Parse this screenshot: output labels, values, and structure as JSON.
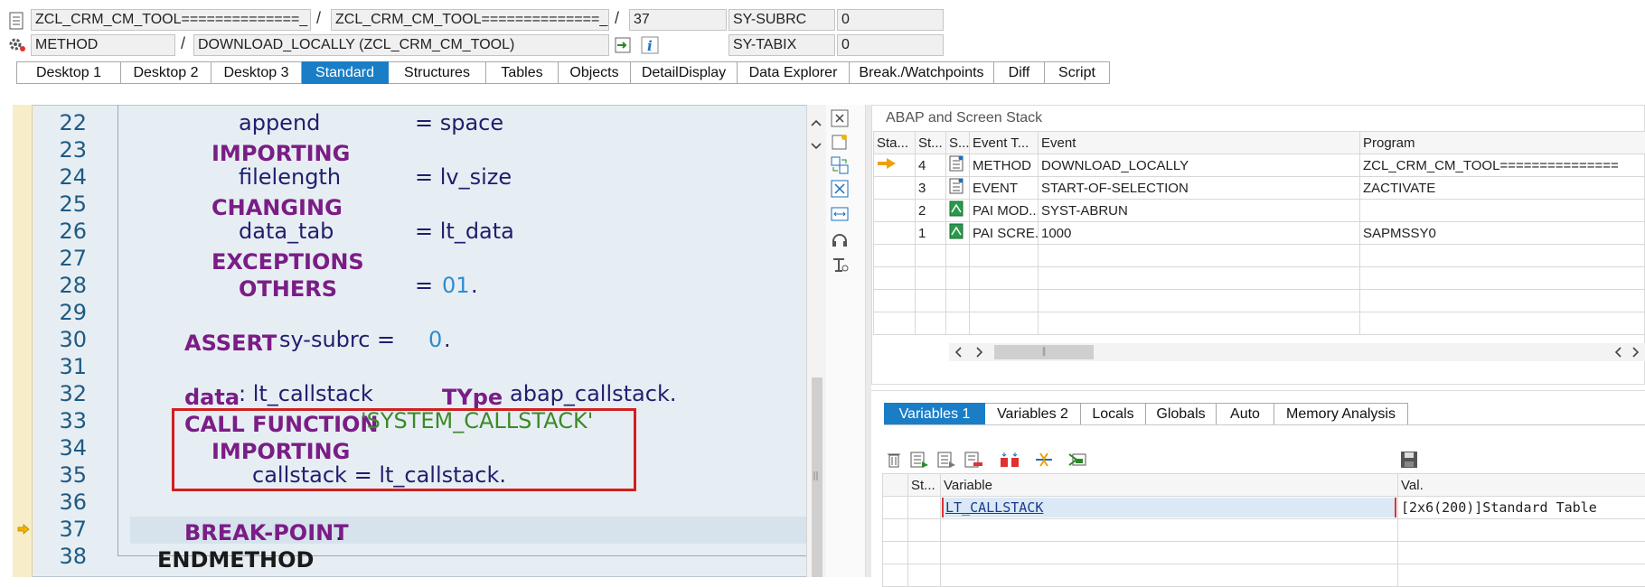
{
  "header": {
    "row1": {
      "prog1": "ZCL_CRM_CM_TOOL==============_",
      "prog2": "ZCL_CRM_CM_TOOL==============_",
      "line": "37",
      "sysvar": "SY-SUBRC",
      "sysval": "0"
    },
    "row2": {
      "type": "METHOD",
      "name": "DOWNLOAD_LOCALLY (ZCL_CRM_CM_TOOL)",
      "sysvar": "SY-TABIX",
      "sysval": "0"
    },
    "sep": "/"
  },
  "tabs": [
    "Desktop 1",
    "Desktop 2",
    "Desktop 3",
    "Standard",
    "Structures",
    "Tables",
    "Objects",
    "DetailDisplay",
    "Data Explorer",
    "Break./Watchpoints",
    "Diff",
    "Script"
  ],
  "tabs_active": "Standard",
  "editor": {
    "line_numbers": [
      "22",
      "23",
      "24",
      "25",
      "26",
      "27",
      "28",
      "29",
      "30",
      "31",
      "32",
      "33",
      "34",
      "35",
      "36",
      "37",
      "38"
    ],
    "lines": {
      "l22a": "append",
      "l22b": "= space",
      "l23": "IMPORTING",
      "l24a": "filelength",
      "l24b": "= lv_size",
      "l25": "CHANGING",
      "l26a": "data_tab",
      "l26b": "= lt_data",
      "l27": "EXCEPTIONS",
      "l28a": "OTHERS",
      "l28b": "=",
      "l28c": "01",
      "l28d": ".",
      "l30a": "ASSERT",
      "l30b": "sy-subrc =",
      "l30c": "0",
      "l30d": ".",
      "l32a": "data",
      "l32b": ": lt_callstack",
      "l32c": "TYpe",
      "l32d": "abap_callstack.",
      "l33a": "CALL FUNCTION",
      "l33b": "'SYSTEM_CALLSTACK'",
      "l34": "IMPORTING",
      "l35": "callstack = lt_callstack.",
      "l37": "BREAK-POINT",
      "l37dot": ".",
      "l38": "ENDMETHOD",
      "l38dot": "."
    }
  },
  "stack": {
    "title": "ABAP and Screen Stack",
    "headers": [
      "Sta...",
      "St...",
      "S...",
      "Event T...",
      "Event",
      "Program"
    ],
    "rows": [
      {
        "level": "4",
        "type": "METHOD",
        "event": "DOWNLOAD_LOCALLY",
        "program": "ZCL_CRM_CM_TOOL==============="
      },
      {
        "level": "3",
        "type": "EVENT",
        "event": "START-OF-SELECTION",
        "program": "ZACTIVATE"
      },
      {
        "level": "2",
        "type": "PAI MOD...",
        "event": "SYST-ABRUN",
        "program": ""
      },
      {
        "level": "1",
        "type": "PAI SCRE...",
        "event": "1000",
        "program": "SAPMSSY0"
      }
    ],
    "hthumb": "∥"
  },
  "var_tabs": [
    "Variables 1",
    "Variables 2",
    "Locals",
    "Globals",
    "Auto",
    "Memory Analysis"
  ],
  "var_tabs_active": "Variables 1",
  "variables": {
    "headers": [
      "St...",
      "Variable",
      "Val."
    ],
    "rows": [
      {
        "variable": "LT_CALLSTACK",
        "value": "[2x6(200)]Standard Table"
      }
    ]
  },
  "colors": {
    "accent": "#1a7ec7",
    "keyword": "#7a1d86",
    "highlight_box": "#d02020",
    "arrow": "#f0a000"
  }
}
